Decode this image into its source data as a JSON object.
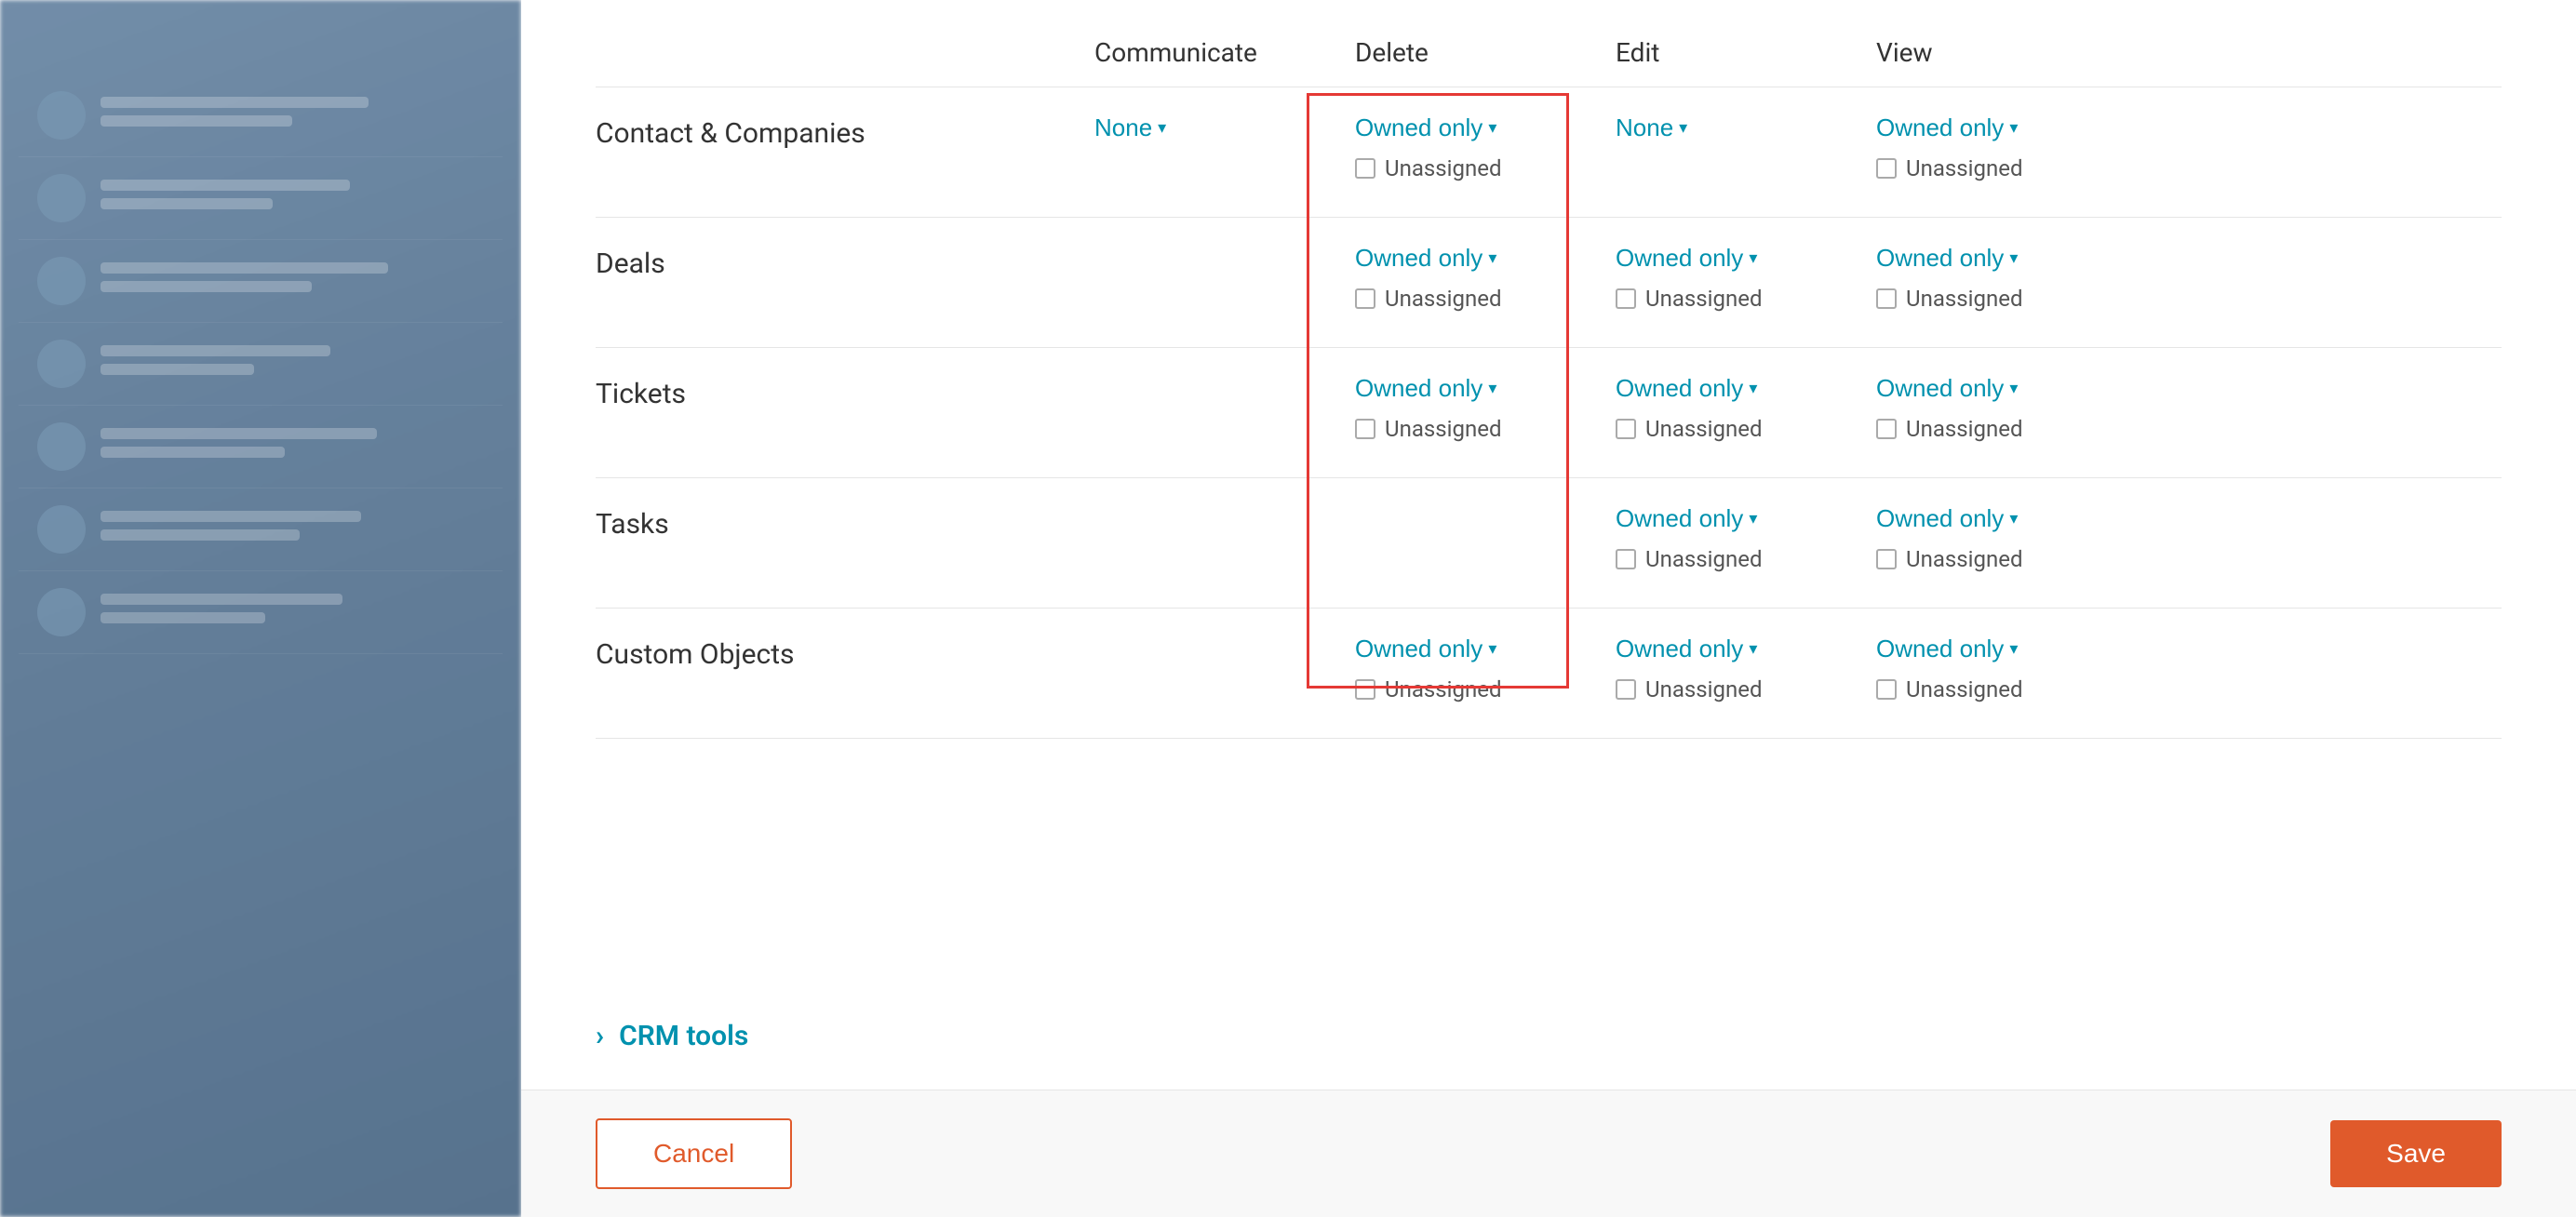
{
  "background": {
    "list_items": [
      {
        "id": 1
      },
      {
        "id": 2
      },
      {
        "id": 3
      },
      {
        "id": 4
      },
      {
        "id": 5
      },
      {
        "id": 6
      },
      {
        "id": 7
      }
    ]
  },
  "columns": {
    "communicate": "Communicate",
    "delete": "Delete",
    "edit": "Edit",
    "view": "View"
  },
  "rows": [
    {
      "label": "Contact & Companies",
      "communicate": {
        "type": "dropdown",
        "value": "None"
      },
      "delete": {
        "type": "dropdown",
        "value": "Owned only",
        "show_checkbox": true
      },
      "edit": {
        "type": "dropdown",
        "value": "None"
      },
      "view": {
        "type": "dropdown",
        "value": "Owned only",
        "show_checkbox": true
      }
    },
    {
      "label": "Deals",
      "communicate": null,
      "delete": {
        "type": "dropdown",
        "value": "Owned only",
        "show_checkbox": true
      },
      "edit": {
        "type": "dropdown",
        "value": "Owned only",
        "show_checkbox": true
      },
      "view": {
        "type": "dropdown",
        "value": "Owned only",
        "show_checkbox": true
      }
    },
    {
      "label": "Tickets",
      "communicate": null,
      "delete": {
        "type": "dropdown",
        "value": "Owned only",
        "show_checkbox": true
      },
      "edit": {
        "type": "dropdown",
        "value": "Owned only",
        "show_checkbox": true
      },
      "view": {
        "type": "dropdown",
        "value": "Owned only",
        "show_checkbox": true
      }
    },
    {
      "label": "Tasks",
      "communicate": null,
      "delete": null,
      "edit": {
        "type": "dropdown",
        "value": "Owned only",
        "show_checkbox": true
      },
      "view": {
        "type": "dropdown",
        "value": "Owned only",
        "show_checkbox": true
      }
    },
    {
      "label": "Custom Objects",
      "communicate": null,
      "delete": {
        "type": "dropdown",
        "value": "Owned only",
        "show_checkbox": true
      },
      "edit": {
        "type": "dropdown",
        "value": "Owned only",
        "show_checkbox": true
      },
      "view": {
        "type": "dropdown",
        "value": "Owned only",
        "show_checkbox": true
      }
    }
  ],
  "crm_tools": {
    "label": "CRM tools"
  },
  "footer": {
    "cancel_label": "Cancel",
    "save_label": "Save"
  },
  "unassigned_label": "Unassigned",
  "chevron_down": "▾",
  "chevron_right": "›"
}
